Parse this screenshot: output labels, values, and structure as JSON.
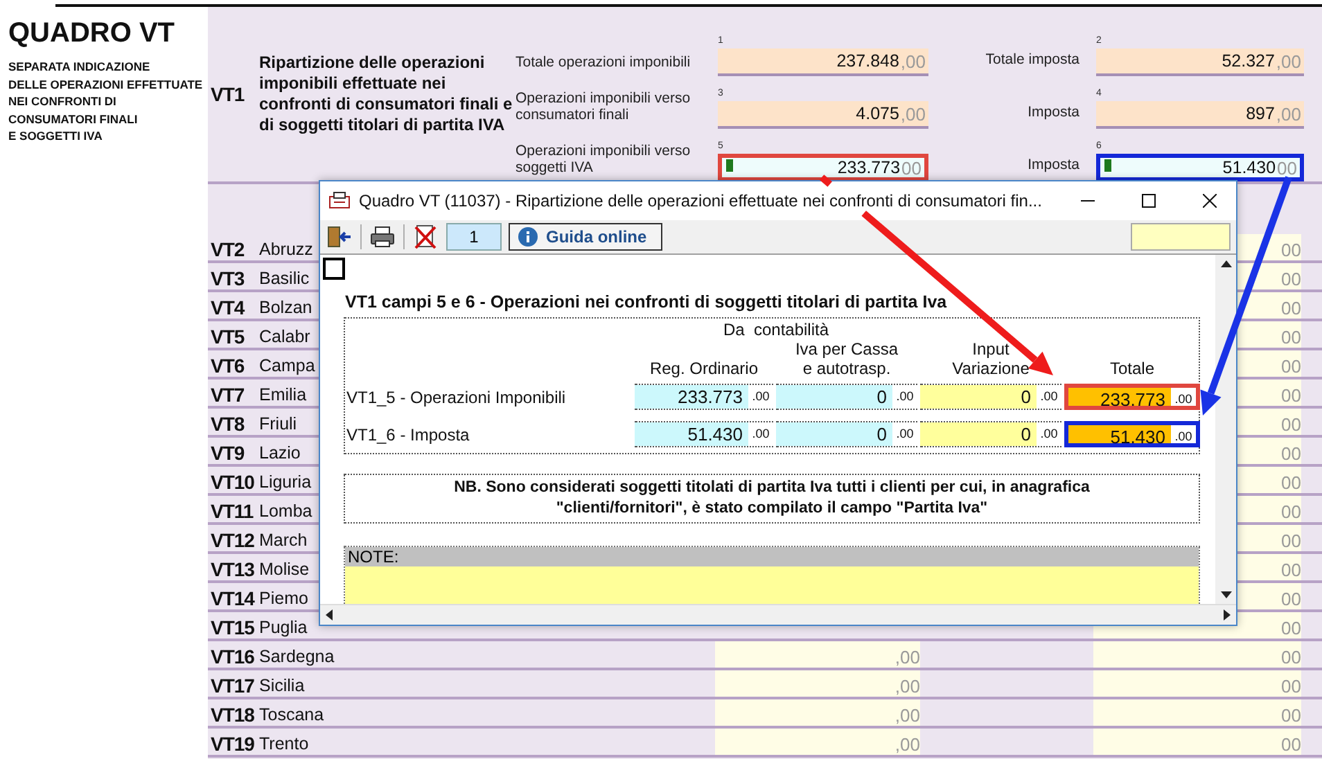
{
  "header": {
    "title": "QUADRO VT",
    "subtitle_lines": [
      "SEPARATA INDICAZIONE",
      "DELLE OPERAZIONI EFFETTUATE",
      "NEI CONFRONTI DI",
      "CONSUMATORI FINALI",
      "E SOGGETTI IVA"
    ]
  },
  "vt1": {
    "code": "VT1",
    "description": "Ripartizione delle operazioni imponibili effettuate nei confronti di consumatori finali e di soggetti titolari di partita IVA",
    "lines": [
      {
        "label": "Totale operazioni imponibili",
        "left": {
          "number": "1",
          "value": "237.848",
          "decimals": ",00",
          "flagged": false
        },
        "tax_label": "Totale imposta",
        "right": {
          "number": "2",
          "value": "52.327",
          "decimals": ",00",
          "flagged": false
        }
      },
      {
        "label": "Operazioni imponibili verso consumatori finali",
        "left": {
          "number": "3",
          "value": "4.075",
          "decimals": ",00",
          "flagged": false
        },
        "tax_label": "Imposta",
        "right": {
          "number": "4",
          "value": "897",
          "decimals": ",00",
          "flagged": false
        }
      },
      {
        "label": "Operazioni imponibili verso soggetti IVA",
        "left": {
          "number": "5",
          "value": "233.773",
          "decimals": "00",
          "flagged": true,
          "color": "#e0473f"
        },
        "tax_label": "Imposta",
        "right": {
          "number": "6",
          "value": "51.430",
          "decimals": "00",
          "flagged": true,
          "color": "#1428d8"
        }
      }
    ]
  },
  "rows": [
    {
      "code": "VT2",
      "name": "Abruzz",
      "amount_2": "00"
    },
    {
      "code": "VT3",
      "name": "Basilic",
      "amount_2": "00"
    },
    {
      "code": "VT4",
      "name": "Bolzan",
      "amount_2": "00"
    },
    {
      "code": "VT5",
      "name": "Calabr",
      "amount_2": "00"
    },
    {
      "code": "VT6",
      "name": "Campa",
      "amount_2": "00"
    },
    {
      "code": "VT7",
      "name": "Emilia",
      "amount_2": "00"
    },
    {
      "code": "VT8",
      "name": "Friuli",
      "amount_2": "00"
    },
    {
      "code": "VT9",
      "name": "Lazio",
      "amount_2": "00"
    },
    {
      "code": "VT10",
      "name": "Liguria",
      "amount_2": "00"
    },
    {
      "code": "VT11",
      "name": "Lomba",
      "amount_2": "00"
    },
    {
      "code": "VT12",
      "name": "March",
      "amount_2": "00"
    },
    {
      "code": "VT13",
      "name": "Molise",
      "amount_2": "00"
    },
    {
      "code": "VT14",
      "name": "Piemo",
      "amount_2": "00"
    },
    {
      "code": "VT15",
      "name": "Puglia",
      "amount_2": "00"
    },
    {
      "code": "VT16",
      "name": "Sardegna",
      "amount_1": ",00",
      "amount_2": "00"
    },
    {
      "code": "VT17",
      "name": "Sicilia",
      "amount_1": ",00",
      "amount_2": "00"
    },
    {
      "code": "VT18",
      "name": "Toscana",
      "amount_1": ",00",
      "amount_2": "00"
    },
    {
      "code": "VT19",
      "name": "Trento",
      "amount_1": ",00",
      "amount_2": "00"
    }
  ],
  "dialog": {
    "title": "Quadro VT (11037) - Ripartizione delle operazioni effettuate nei confronti di consumatori fin...",
    "page": "1",
    "help": "Guida online",
    "checked": false,
    "heading": "VT1 campi 5 e 6 - Operazioni nei confronti di soggetti titolari di partita Iva",
    "group_label": "Da  contabilità",
    "columns": [
      "Reg. Ordinario",
      "Iva per Cassa\ne autotrasp.",
      "Input\nVariazione",
      "Totale"
    ],
    "rows": [
      {
        "label": "VT1_5 - Operazioni Imponibili",
        "cells": [
          {
            "kind": "computed",
            "value": "233.773",
            "decimals": ".00"
          },
          {
            "kind": "computed",
            "value": "0",
            "decimals": ".00"
          },
          {
            "kind": "input",
            "value": "0",
            "decimals": ".00"
          },
          {
            "kind": "total",
            "value": "233.773",
            "decimals": ".00",
            "color": "#e0473f"
          }
        ]
      },
      {
        "label": "VT1_6 - Imposta",
        "cells": [
          {
            "kind": "computed",
            "value": "51.430",
            "decimals": ".00"
          },
          {
            "kind": "computed",
            "value": "0",
            "decimals": ".00"
          },
          {
            "kind": "input",
            "value": "0",
            "decimals": ".00"
          },
          {
            "kind": "total",
            "value": "51.430",
            "decimals": ".00",
            "color": "#1428d8"
          }
        ]
      }
    ],
    "note": "NB. Sono considerati soggetti titolati di partita Iva tutti i clienti per cui, in anagrafica\n\"clienti/fornitori\", è stato compilato il campo \"Partita Iva\"",
    "notes_label": "NOTE:"
  },
  "annotations": [
    {
      "color": "#ee1c1c"
    },
    {
      "color": "#1a33e6"
    }
  ]
}
